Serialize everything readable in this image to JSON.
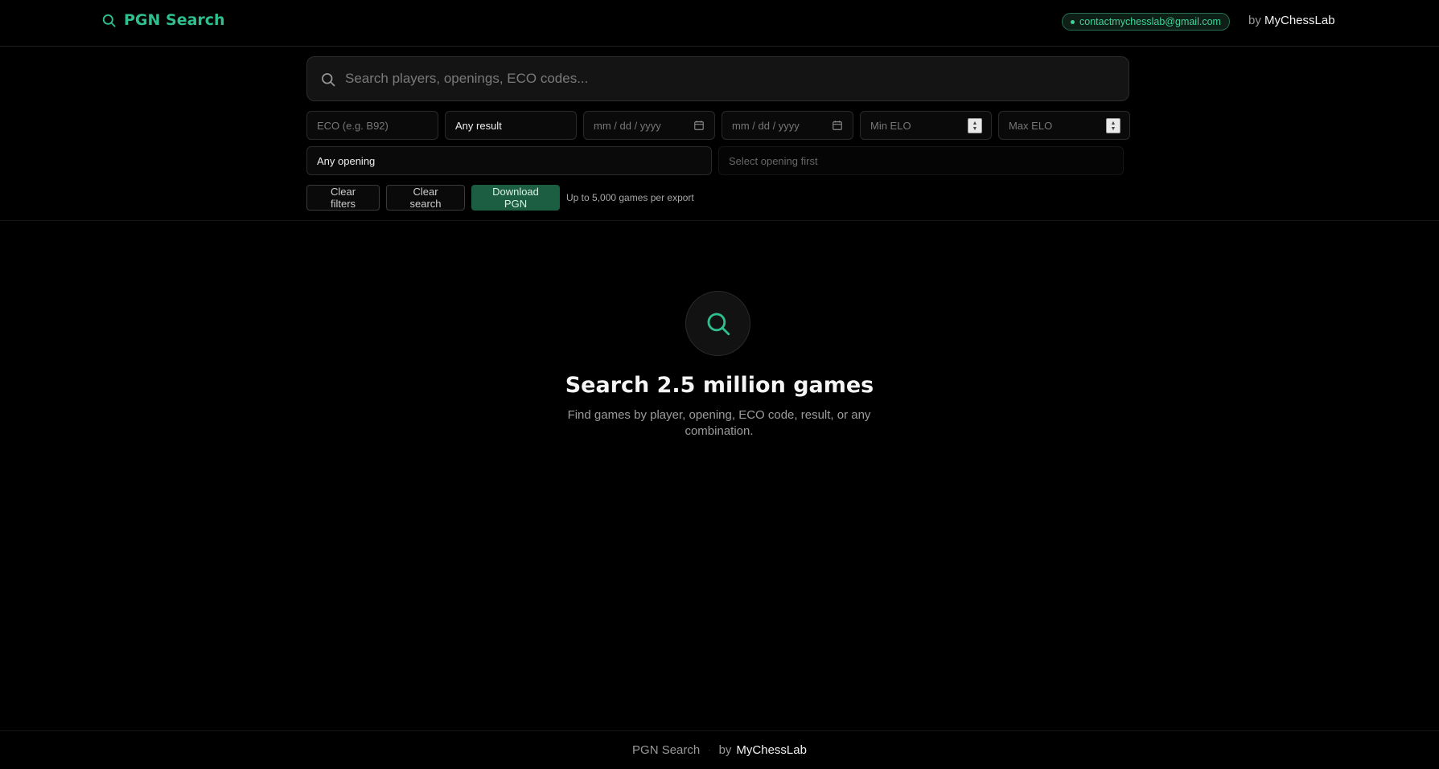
{
  "header": {
    "brand_label": "PGN Search",
    "contact_email": "contactmychesslab@gmail.com",
    "by_prefix": "by",
    "by_name": "MyChessLab"
  },
  "search": {
    "placeholder": "Search players, openings, ECO codes..."
  },
  "filters": {
    "eco_placeholder": "ECO (e.g. B92)",
    "result_value": "Any result",
    "date_from_placeholder": "mm / dd / yyyy",
    "date_to_placeholder": "mm / dd / yyyy",
    "min_elo_placeholder": "Min ELO",
    "max_elo_placeholder": "Max ELO",
    "opening_value": "Any opening",
    "variation_value": "Select opening first"
  },
  "actions": {
    "clear_filters": "Clear filters",
    "clear_search": "Clear search",
    "download_pgn": "Download PGN",
    "export_note": "Up to 5,000 games per export"
  },
  "empty_state": {
    "icon": "search-icon",
    "title": "Search 2.5 million games",
    "subtitle": "Find games by player, opening, ECO code, result, or any combination."
  },
  "footer": {
    "app_name": "PGN Search",
    "separator": "·",
    "by_prefix": "by",
    "by_name": "MyChessLab"
  },
  "colors": {
    "accent": "#2fbf8f",
    "primary_button": "#1c5e41",
    "background": "#000000"
  }
}
